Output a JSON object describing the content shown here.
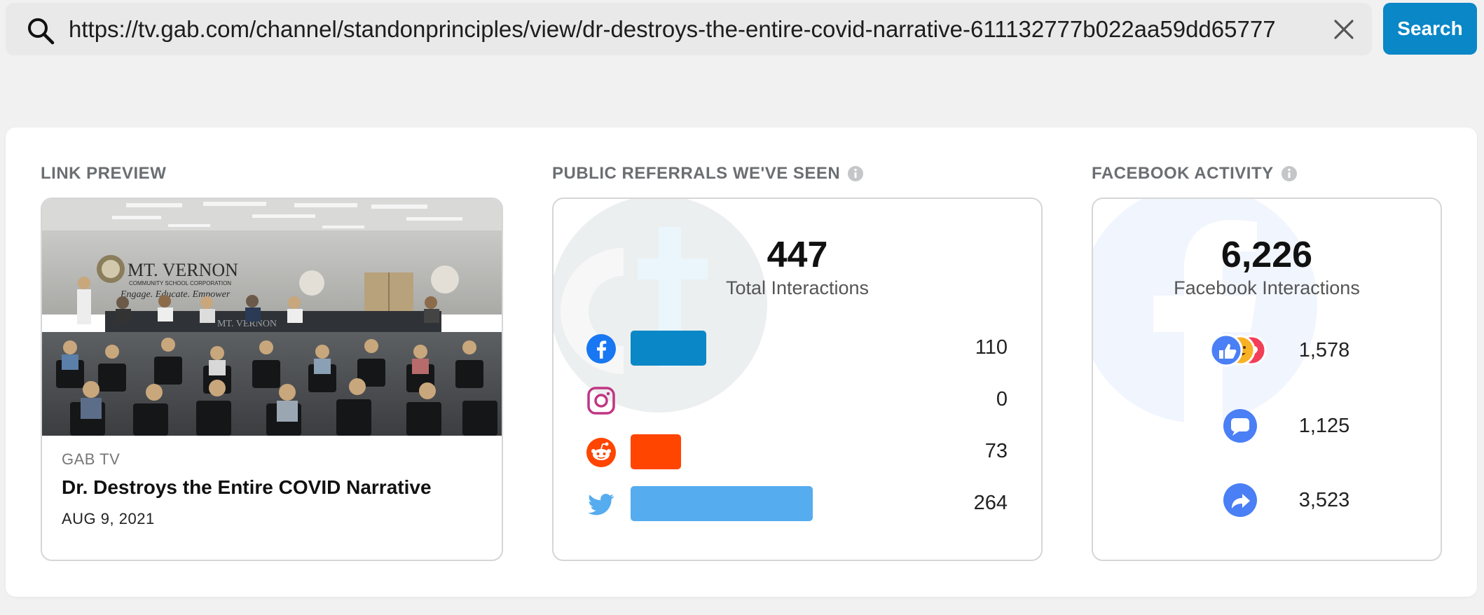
{
  "search": {
    "url": "https://tv.gab.com/channel/standonprinciples/view/dr-destroys-the-entire-covid-narrative-611132777b022aa59dd65777",
    "button_label": "Search"
  },
  "link_preview": {
    "heading": "LINK PREVIEW",
    "source": "GAB TV",
    "title": "Dr. Destroys the Entire COVID Narrative",
    "date": "AUG 9, 2021",
    "thumbnail_text": {
      "brand": "MT. VERNON",
      "subbrand": "COMMUNITY SCHOOL CORPORATION",
      "tagline": "Engage. Educate. Empower",
      "table_banner": "MT. VERNON"
    }
  },
  "referrals": {
    "heading": "PUBLIC REFERRALS WE'VE SEEN",
    "total": "447",
    "total_label": "Total Interactions",
    "rows": [
      {
        "platform": "facebook",
        "icon": "facebook-icon",
        "value": "110",
        "count": 110,
        "color": "#0a87c7"
      },
      {
        "platform": "instagram",
        "icon": "instagram-icon",
        "value": "0",
        "count": 0,
        "color": "#d6336c"
      },
      {
        "platform": "reddit",
        "icon": "reddit-icon",
        "value": "73",
        "count": 73,
        "color": "#ff4500"
      },
      {
        "platform": "twitter",
        "icon": "twitter-icon",
        "value": "264",
        "count": 264,
        "color": "#55acee"
      }
    ]
  },
  "facebook": {
    "heading": "FACEBOOK ACTIVITY",
    "total": "6,226",
    "total_label": "Facebook Interactions",
    "rows": [
      {
        "type": "reactions",
        "icon": "reactions-icon",
        "value": "1,578"
      },
      {
        "type": "comments",
        "icon": "comment-icon",
        "value": "1,125"
      },
      {
        "type": "shares",
        "icon": "share-icon",
        "value": "3,523"
      }
    ]
  },
  "colors": {
    "accent": "#0a87c7",
    "heading": "#6b6e72",
    "facebook_blue": "#4a7ff5"
  }
}
